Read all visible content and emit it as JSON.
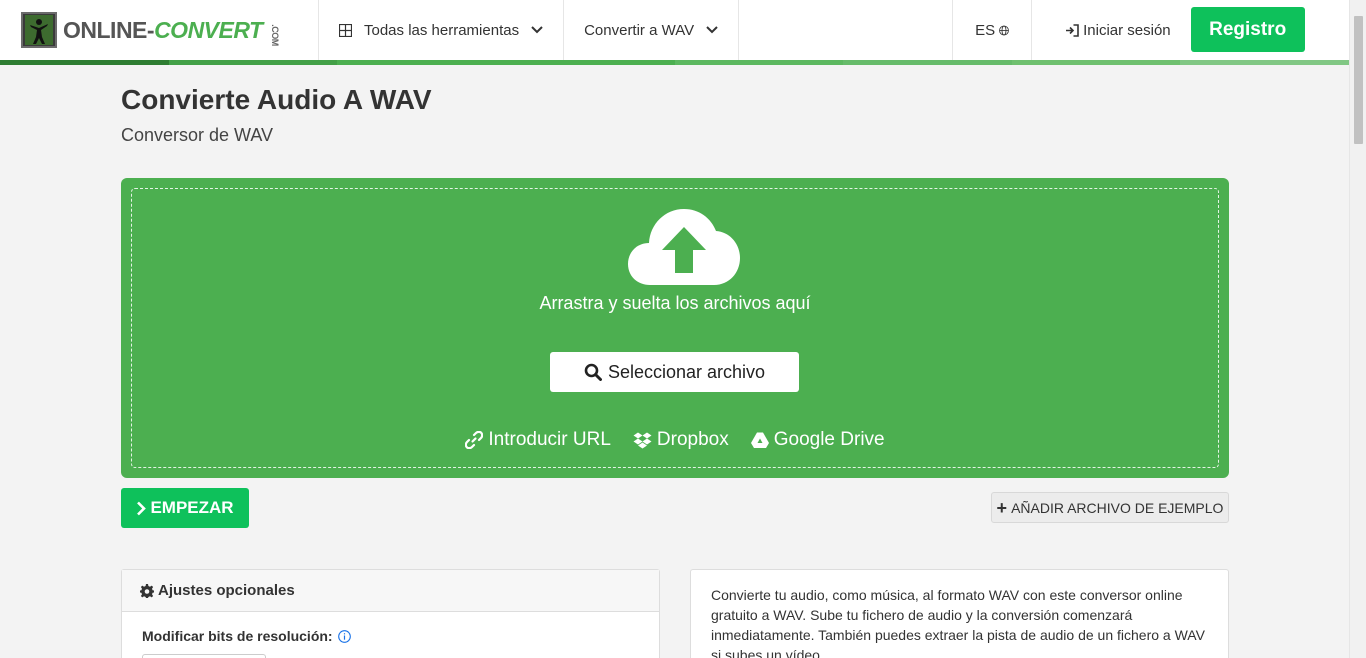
{
  "header": {
    "logo": {
      "text_main": "ONLINE-",
      "text_accent": "CONVERT",
      "text_suffix": ".COM"
    },
    "nav_tools": "Todas las herramientas",
    "nav_convert": "Convertir a WAV",
    "lang": "ES",
    "login": "Iniciar sesión",
    "register": "Registro"
  },
  "colors": {
    "brand_green": "#4caf50",
    "button_green": "#0ec15b",
    "stripe": [
      "#2e7d32",
      "#43a047",
      "#4caf50",
      "#4caf50",
      "#5cb860",
      "#66bb6a",
      "#6fc06f",
      "#81c784"
    ]
  },
  "main": {
    "title": "Convierte Audio A WAV",
    "subtitle": "Conversor de WAV"
  },
  "upload": {
    "icon": "cloud-upload-icon",
    "drop_text": "Arrastra y suelta los archivos aquí",
    "select_label": "Seleccionar archivo",
    "sources": {
      "url": "Introducir URL",
      "dropbox": "Dropbox",
      "gdrive": "Google Drive"
    }
  },
  "actions": {
    "start": "EMPEZAR",
    "sample": "AÑADIR ARCHIVO DE EJEMPLO"
  },
  "settings": {
    "header": "Ajustes opcionales",
    "bits_label": "Modificar bits de resolución:"
  },
  "description": {
    "text": "Convierte tu audio, como música, al formato WAV con este conversor online gratuito a WAV. Sube tu fichero de audio y la conversión comenzará inmediatamente. También puedes extraer la pista de audio de un fichero a WAV si subes un vídeo."
  }
}
